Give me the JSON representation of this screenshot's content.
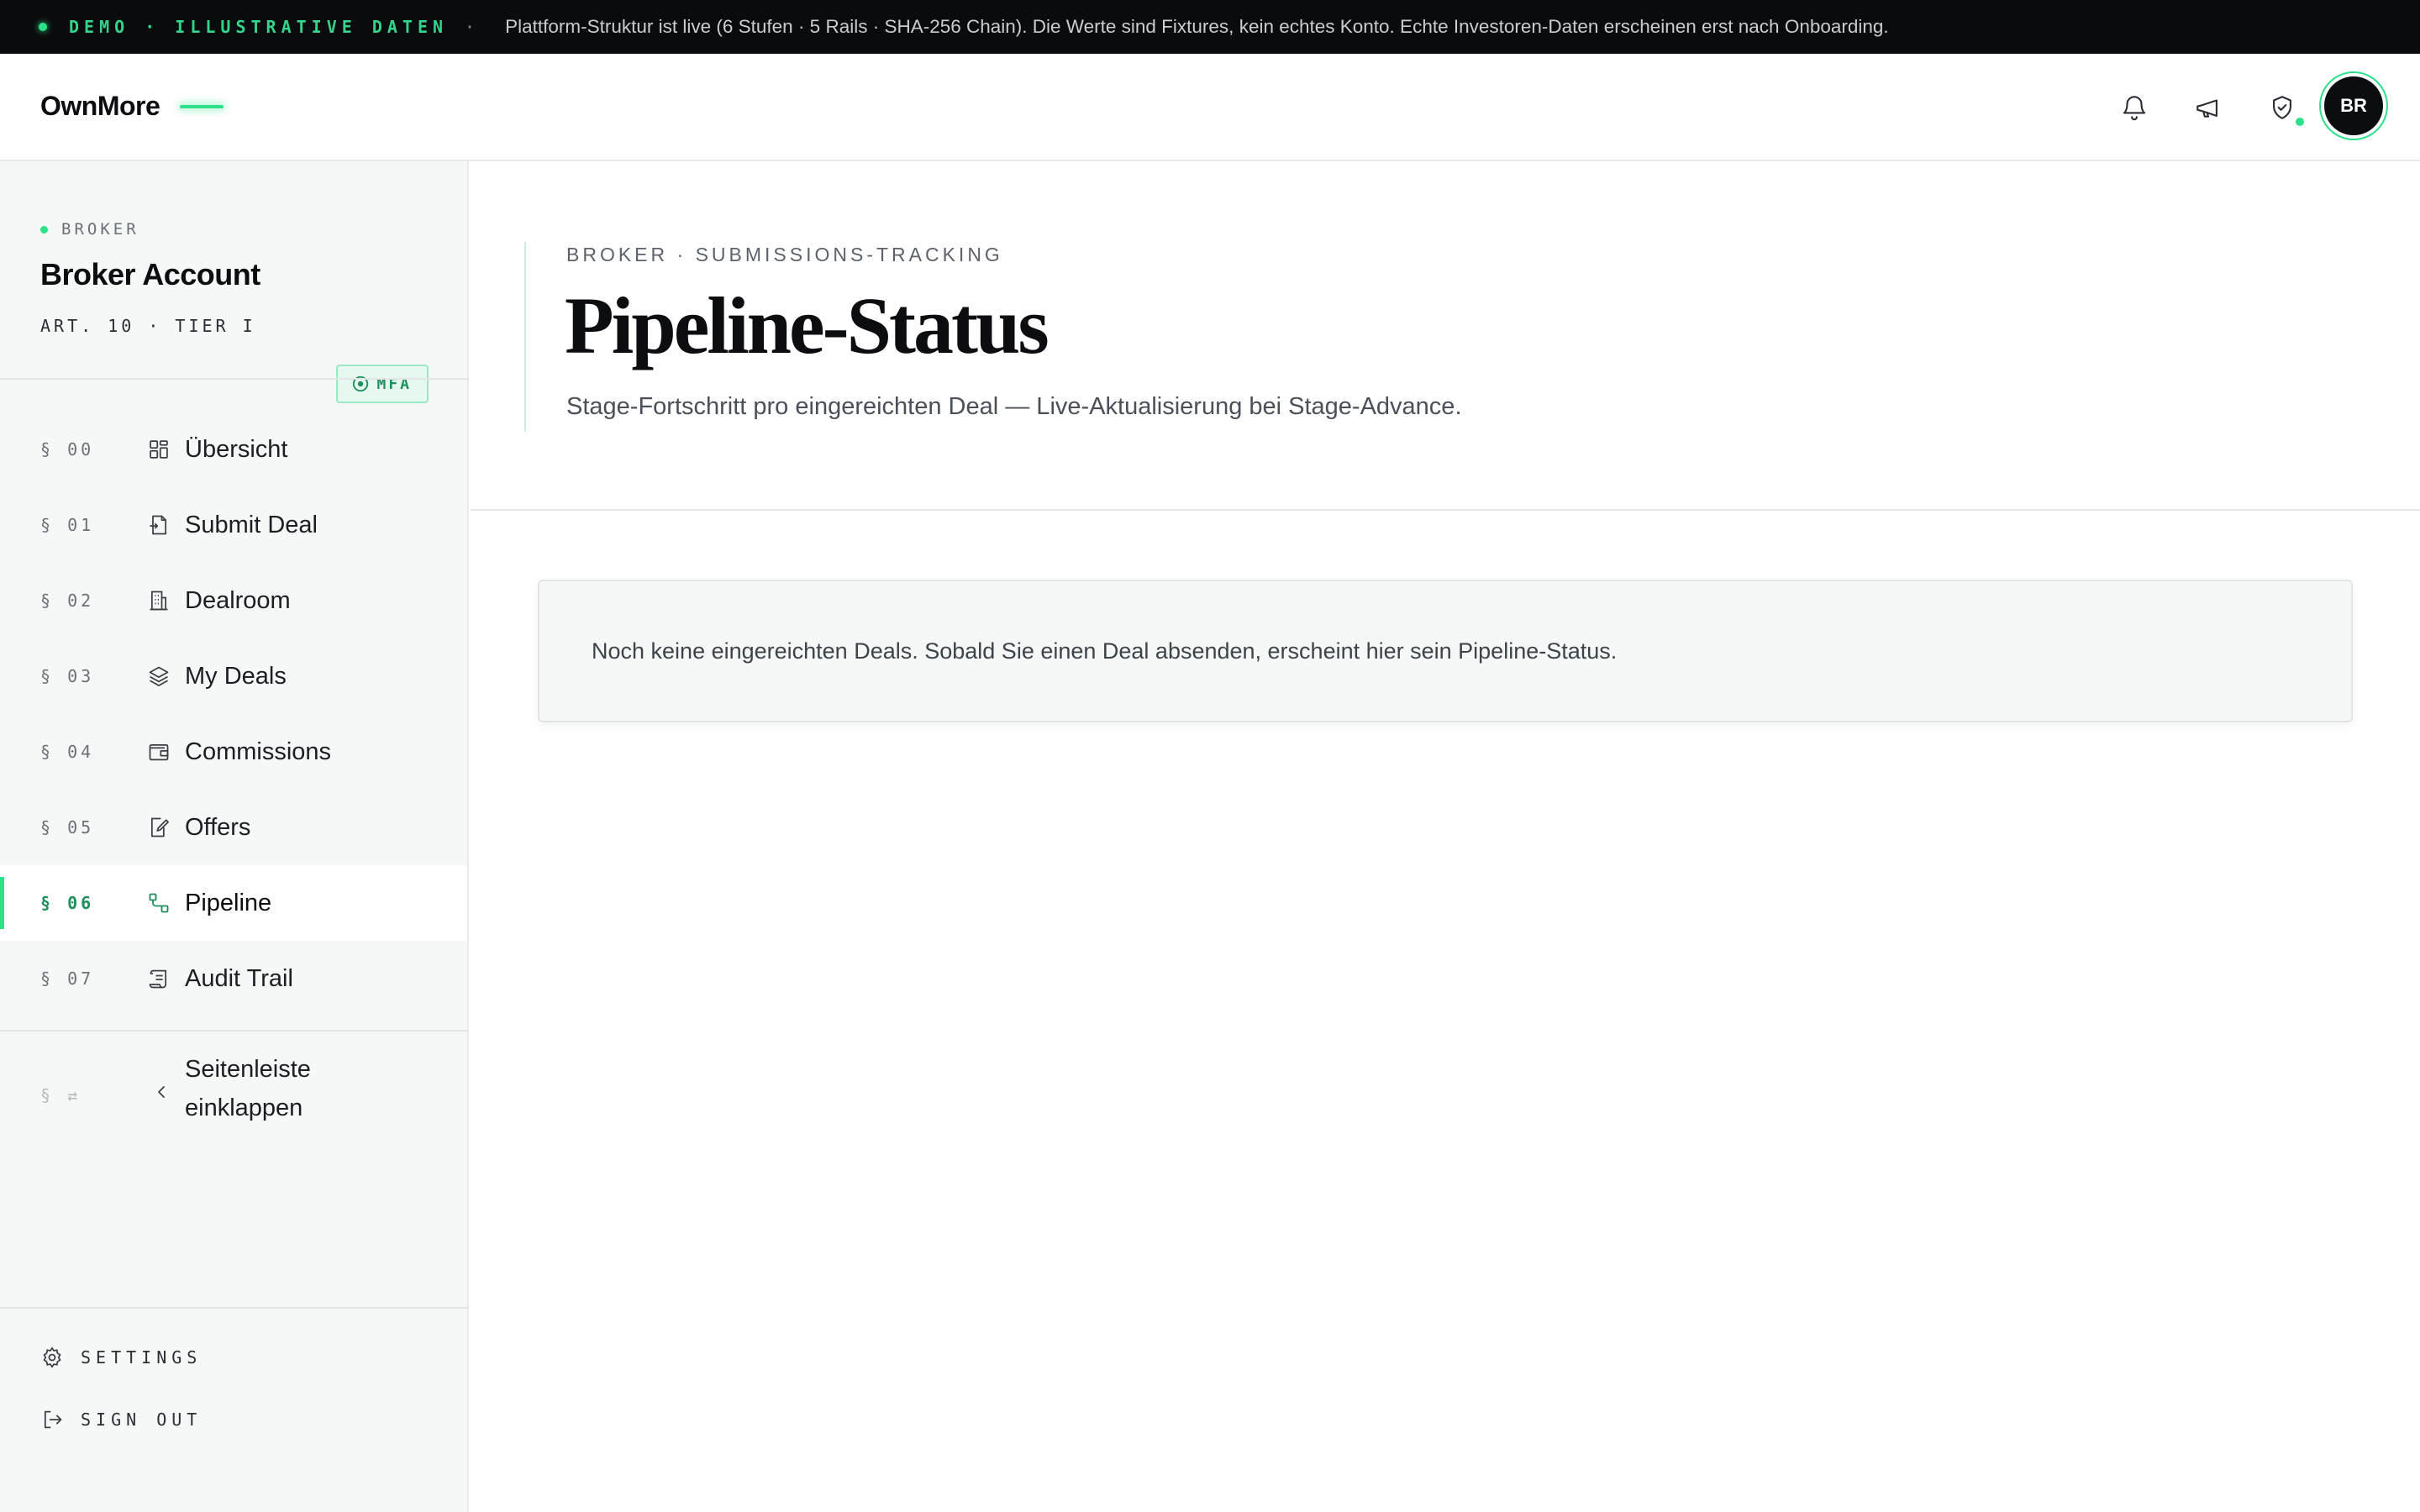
{
  "banner": {
    "tag": "DEMO · ILLUSTRATIVE DATEN",
    "separator": "·",
    "message": "Plattform-Struktur ist live (6 Stufen · 5 Rails · SHA-256 Chain). Die Werte sind Fixtures, kein echtes Konto. Echte Investoren-Daten erscheinen erst nach Onboarding."
  },
  "header": {
    "brand": "OwnMore",
    "avatar_initials": "BR",
    "icons": [
      "bell-icon",
      "megaphone-icon",
      "shield-check-icon"
    ]
  },
  "account": {
    "role": "BROKER",
    "name": "Broker Account",
    "tier": "ART. 10 · TIER I",
    "mfa_badge": "MFA"
  },
  "nav": {
    "items": [
      {
        "num": "§ 00",
        "label": "Übersicht",
        "icon": "grid-icon"
      },
      {
        "num": "§ 01",
        "label": "Submit Deal",
        "icon": "file-submit-icon"
      },
      {
        "num": "§ 02",
        "label": "Dealroom",
        "icon": "building-icon"
      },
      {
        "num": "§ 03",
        "label": "My Deals",
        "icon": "layers-icon"
      },
      {
        "num": "§ 04",
        "label": "Commissions",
        "icon": "wallet-icon"
      },
      {
        "num": "§ 05",
        "label": "Offers",
        "icon": "file-edit-icon"
      },
      {
        "num": "§ 06",
        "label": "Pipeline",
        "icon": "route-icon",
        "active": true
      },
      {
        "num": "§ 07",
        "label": "Audit Trail",
        "icon": "scroll-icon"
      }
    ],
    "collapse": {
      "num": "§ ⇄",
      "label": "Seitenleiste einklappen"
    }
  },
  "footer": {
    "settings": "SETTINGS",
    "sign_out": "SIGN OUT"
  },
  "page": {
    "eyebrow": "BROKER · SUBMISSIONS-TRACKING",
    "title": "Pipeline-Status",
    "subtitle": "Stage-Fortschritt pro eingereichten Deal — Live-Aktualisierung bei Stage-Advance.",
    "empty_message": "Noch keine eingereichten Deals. Sobald Sie einen Deal absenden, erscheint hier sein Pipeline-Status."
  },
  "colors": {
    "accent": "#2ee08a",
    "banner_bg": "#0a0b0c",
    "sidebar_bg": "#f6f7f7"
  }
}
